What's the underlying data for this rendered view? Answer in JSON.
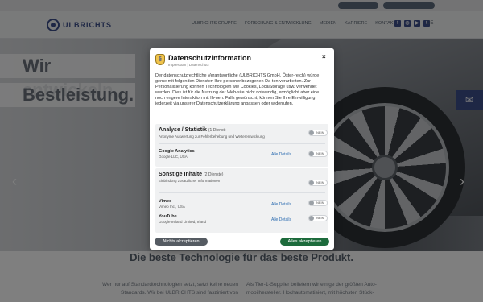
{
  "site": {
    "topbar": {
      "login_label": "",
      "contact_label": ""
    },
    "logo_text": "ULBRICHTS",
    "nav": [
      "ULBRICHTS GRUPPE",
      "FORSCHUNG & ENTWICKLUNG",
      "MEDIEN",
      "KARRIERE",
      "KONTAKT"
    ],
    "social_icons": [
      "facebook-icon",
      "instagram-icon",
      "youtube-icon",
      "twitter-icon"
    ],
    "language": "DE",
    "hero": {
      "line1": "Wir entwickeln",
      "line2": "Bestleistung."
    },
    "section_title": "Die beste Technologie für das beste Produkt.",
    "col_left": "Wer nur auf Standardtechnologien setzt, setzt keine neuen Standards. Wir bei ULBRICHTS sind fasziniert von",
    "col_right": "Als Tier-1-Supplier beliefern wir einige der größten Auto-mobilhersteller. Hochautomatisiert, mit höchsten Stück-"
  },
  "dialog": {
    "title": "Datenschutzinformation",
    "links": "Impressum | Datenschutz",
    "close": "×",
    "intro": "Der datenschutzrechtliche Verantwortliche (ULBRICHTS GmbH, Öster-reich) würde gerne mit folgenden Diensten Ihre personenbezogenen Da-ten verarbeiten. Zur Personalisierung können Technologien wie Cookies, LocalStorage usw. verwendet werden. Dies ist für die Nutzung der Web-site nicht notwendig, ermöglicht aber eine noch engere Interaktion mit Ih-nen. Falls gewünscht, können Sie Ihre Einwilligung jederzeit via unserer Datenschutzerklärung anpassen oder widerrufen.",
    "categories": [
      {
        "title": "Analyse / Statistik",
        "count": "(1 Dienst)",
        "description": "Anonyme Auswertung zur Fehlerbehebung und Weiterentwicklung",
        "toggle": "NEIN",
        "services": [
          {
            "name": "Google Analytics",
            "company": "Google LLC, USA",
            "details": "Alle Details",
            "toggle": "NEIN"
          }
        ]
      },
      {
        "title": "Sonstige Inhalte",
        "count": "(2 Dienste)",
        "description": "Einbindung zusätzlicher Informationen",
        "toggle": "NEIN",
        "services": [
          {
            "name": "Vimeo",
            "company": "Vimeo Inc., USA",
            "details": "Alle Details",
            "toggle": "NEIN"
          },
          {
            "name": "YouTube",
            "company": "Google Ireland Limited, Irland",
            "details": "Alle Details",
            "toggle": "NEIN"
          }
        ]
      }
    ],
    "reject_label": "Nichts akzeptieren",
    "accept_label": "Alles akzeptieren"
  },
  "colors": {
    "brand": "#3d4f8a",
    "accept": "#1d6b3c",
    "reject": "#555b62",
    "link": "#2a6bb0"
  }
}
